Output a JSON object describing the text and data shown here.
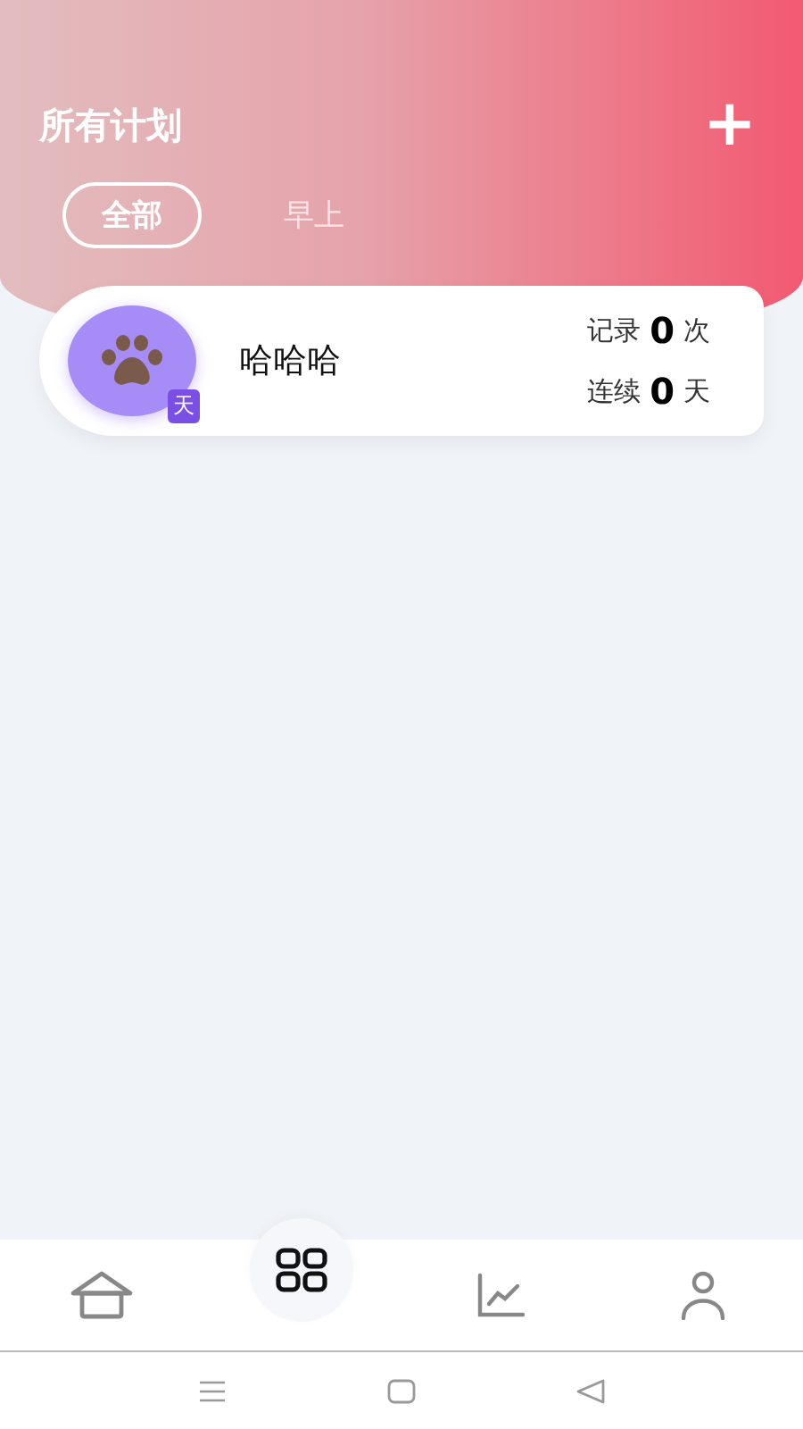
{
  "header": {
    "title": "所有计划",
    "add_symbol": "+"
  },
  "tabs": [
    {
      "label": "全部",
      "selected": true
    },
    {
      "label": "早上",
      "selected": false
    }
  ],
  "plans": [
    {
      "name": "哈哈哈",
      "badge": "天",
      "stats": [
        {
          "label": "记录",
          "value": "0",
          "unit": "次"
        },
        {
          "label": "连续",
          "value": "0",
          "unit": "天"
        }
      ]
    }
  ],
  "bottom_nav": [
    {
      "kind": "home",
      "selected": false
    },
    {
      "kind": "plans",
      "selected": true
    },
    {
      "kind": "stats",
      "selected": false
    },
    {
      "kind": "profile",
      "selected": false
    }
  ]
}
